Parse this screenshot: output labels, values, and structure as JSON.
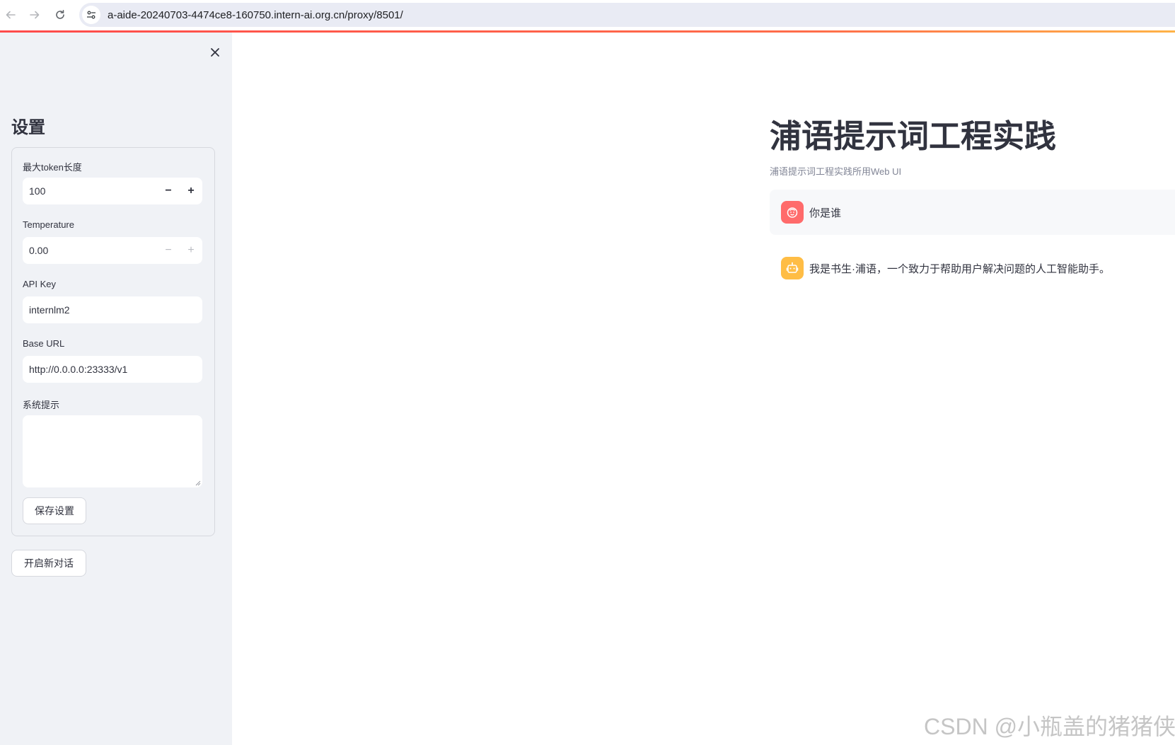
{
  "browser": {
    "url": "a-aide-20240703-4474ce8-160750.intern-ai.org.cn/proxy/8501/"
  },
  "sidebar": {
    "title": "设置",
    "fields": {
      "max_tokens": {
        "label": "最大token长度",
        "value": "100"
      },
      "temperature": {
        "label": "Temperature",
        "value": "0.00"
      },
      "api_key": {
        "label": "API Key",
        "value": "internlm2"
      },
      "base_url": {
        "label": "Base URL",
        "value": "http://0.0.0.0:23333/v1"
      },
      "system_prompt": {
        "label": "系统提示",
        "value": ""
      }
    },
    "save_button": "保存设置",
    "new_chat_button": "开启新对话"
  },
  "main": {
    "title": "浦语提示词工程实践",
    "caption": "浦语提示词工程实践所用Web UI",
    "messages": [
      {
        "role": "user",
        "text": "你是谁"
      },
      {
        "role": "assistant",
        "text": "我是书生·浦语，一个致力于帮助用户解决问题的人工智能助手。"
      }
    ]
  },
  "watermark": "CSDN @小瓶盖的猪猪侠",
  "colors": {
    "accent": "#ff4b4b",
    "sidebar_bg": "#f0f2f6",
    "user_avatar": "#ff6b6b",
    "assistant_avatar": "#ffbd45"
  }
}
